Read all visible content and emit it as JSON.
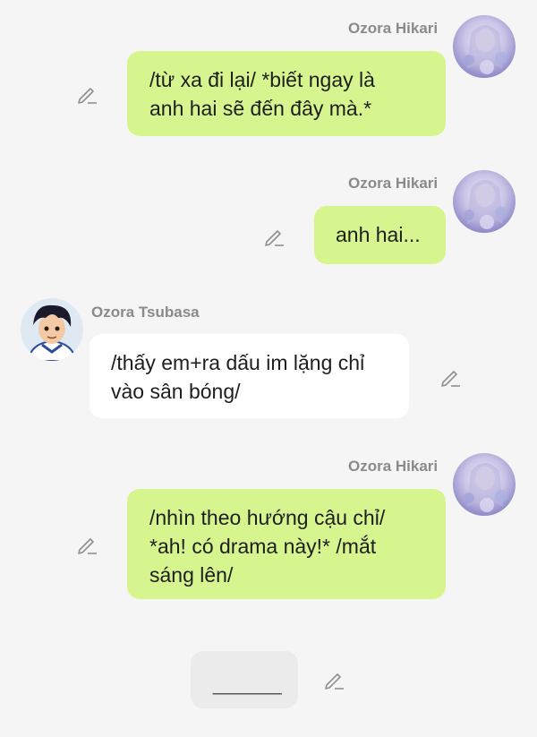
{
  "messages": [
    {
      "sender": "Ozora Hikari",
      "side": "right",
      "text_lines": [
        "/từ xa đi lại/ *biết ngay là",
        "anh hai sẽ đến đây mà.*"
      ]
    },
    {
      "sender": "Ozora Hikari",
      "side": "right",
      "text_lines": [
        "anh hai..."
      ]
    },
    {
      "sender": "Ozora Tsubasa",
      "side": "left",
      "text_lines": [
        "/thấy em+ra dấu im lặng chỉ",
        "vào sân bóng/"
      ]
    },
    {
      "sender": "Ozora Hikari",
      "side": "right",
      "text_lines": [
        "/nhìn theo hướng cậu chỉ/",
        "*ah! có drama này!* /mắt",
        "sáng lên/"
      ]
    }
  ],
  "draft": {
    "text": "______"
  },
  "icons": {
    "edit": "pencil-icon",
    "avatar_hikari": "avatar-hikari",
    "avatar_tsubasa": "avatar-tsubasa"
  },
  "colors": {
    "bubble_me": "#d7f58e",
    "bubble_other": "#ffffff",
    "background": "#f5f5f5",
    "name": "#8a8a8a"
  }
}
